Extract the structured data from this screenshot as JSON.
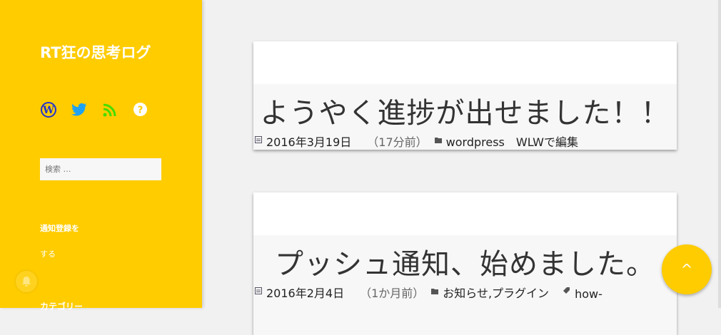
{
  "sidebar": {
    "site_title": "RT狂の思考ログ",
    "social_icons": [
      "wordpress-icon",
      "twitter-icon",
      "rss-icon",
      "help-icon"
    ],
    "search_placeholder": "検索 …",
    "widget_title": "通知登録を",
    "widget_text": "する",
    "categories_title": "カテゴリー"
  },
  "posts": [
    {
      "title": "ようやく進捗が出せました！！",
      "date": "2016年3月19日",
      "ago": "（17分前）",
      "categories": "wordpress　WLWで編集",
      "tags": ""
    },
    {
      "title": "プッシュ通知、始めました。",
      "date": "2016年2月4日",
      "ago": "（1か月前）",
      "categories": "お知らせ,プラグイン",
      "tags": "how-"
    }
  ],
  "scroll_top_label": "^",
  "colors": {
    "accent": "#ffcc00",
    "wordpress": "#2233cc",
    "twitter": "#1da1f2",
    "rss": "#44dd00"
  }
}
